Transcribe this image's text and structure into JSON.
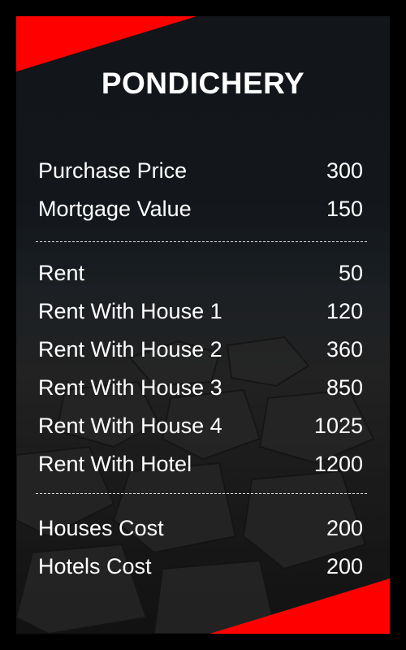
{
  "card": {
    "title": "PONDICHERY",
    "colors": {
      "accent": "#ff0000",
      "text": "#ffffff",
      "frame": "#000000"
    },
    "pricing": [
      {
        "label": "Purchase Price",
        "value": "300"
      },
      {
        "label": "Mortgage Value",
        "value": "150"
      }
    ],
    "rents": [
      {
        "label": "Rent",
        "value": "50"
      },
      {
        "label": "Rent With House 1",
        "value": "120"
      },
      {
        "label": "Rent With House 2",
        "value": "360"
      },
      {
        "label": "Rent With House 3",
        "value": "850"
      },
      {
        "label": "Rent With House 4",
        "value": "1025"
      },
      {
        "label": "Rent With Hotel",
        "value": "1200"
      }
    ],
    "costs": [
      {
        "label": "Houses Cost",
        "value": "200"
      },
      {
        "label": "Hotels Cost",
        "value": "200"
      }
    ]
  }
}
